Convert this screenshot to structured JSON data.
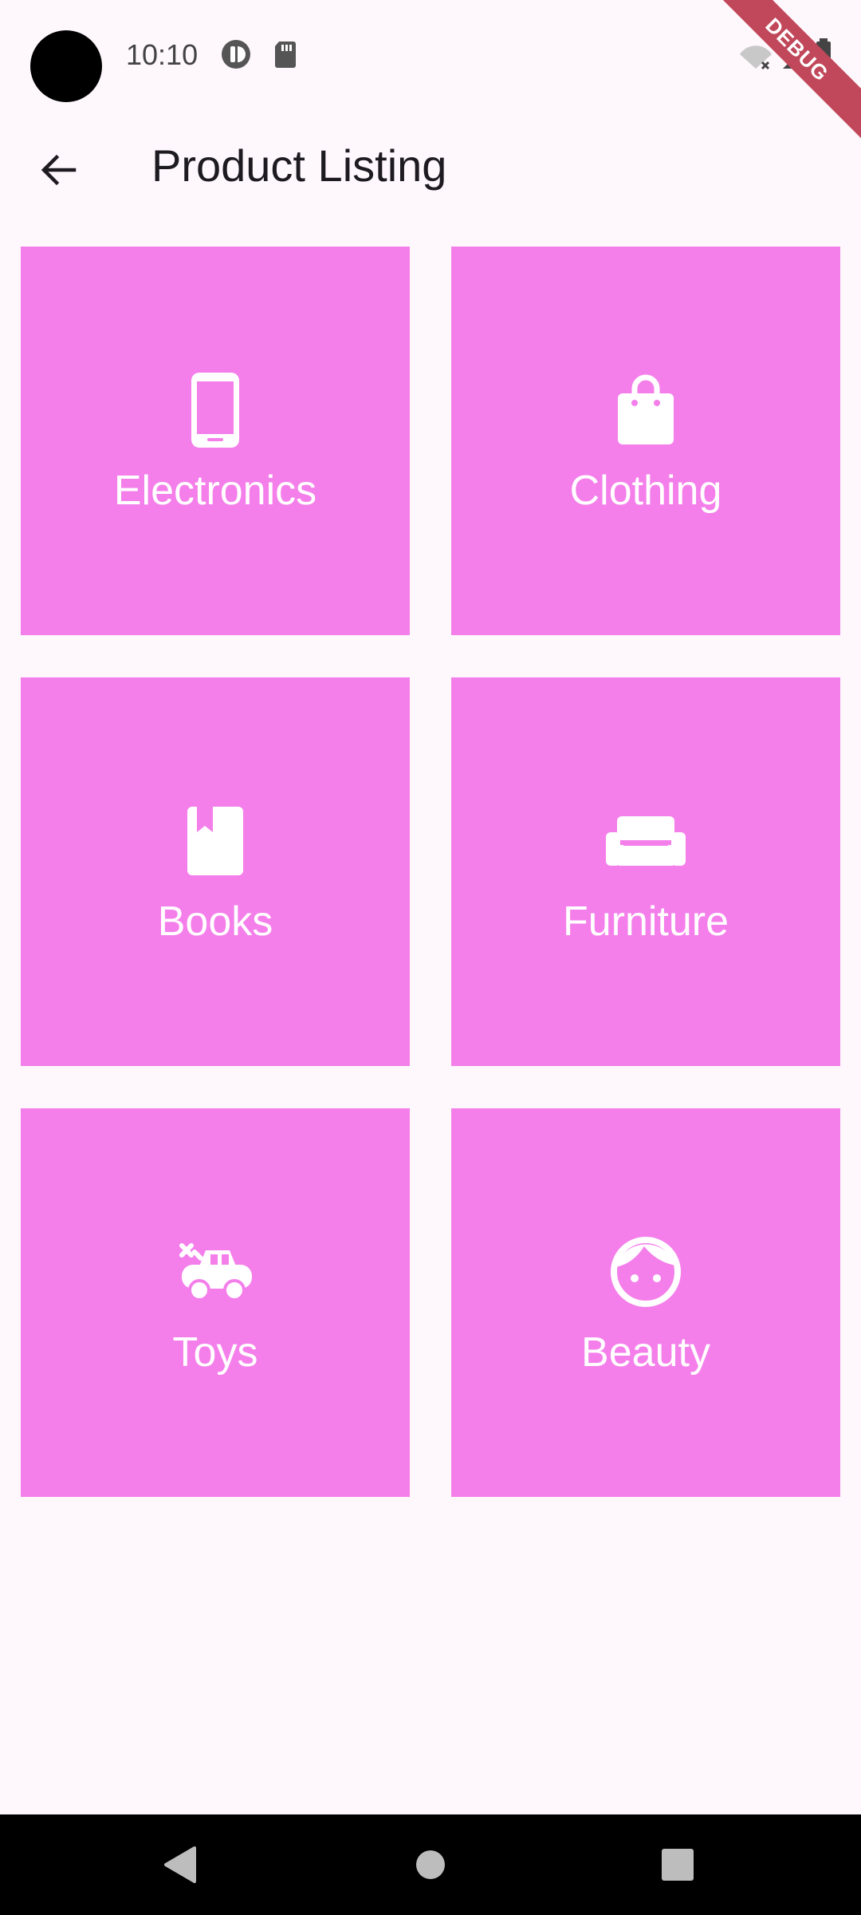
{
  "status_bar": {
    "time": "10:10",
    "debug_label": "DEBUG"
  },
  "app_bar": {
    "title": "Product Listing"
  },
  "tile_color": "#f47fea",
  "categories": [
    {
      "label": "Electronics",
      "icon": "smartphone-icon"
    },
    {
      "label": "Clothing",
      "icon": "shopping-bag-icon"
    },
    {
      "label": "Books",
      "icon": "book-icon"
    },
    {
      "label": "Furniture",
      "icon": "sofa-icon"
    },
    {
      "label": "Toys",
      "icon": "toy-car-icon"
    },
    {
      "label": "Beauty",
      "icon": "face-icon"
    }
  ]
}
